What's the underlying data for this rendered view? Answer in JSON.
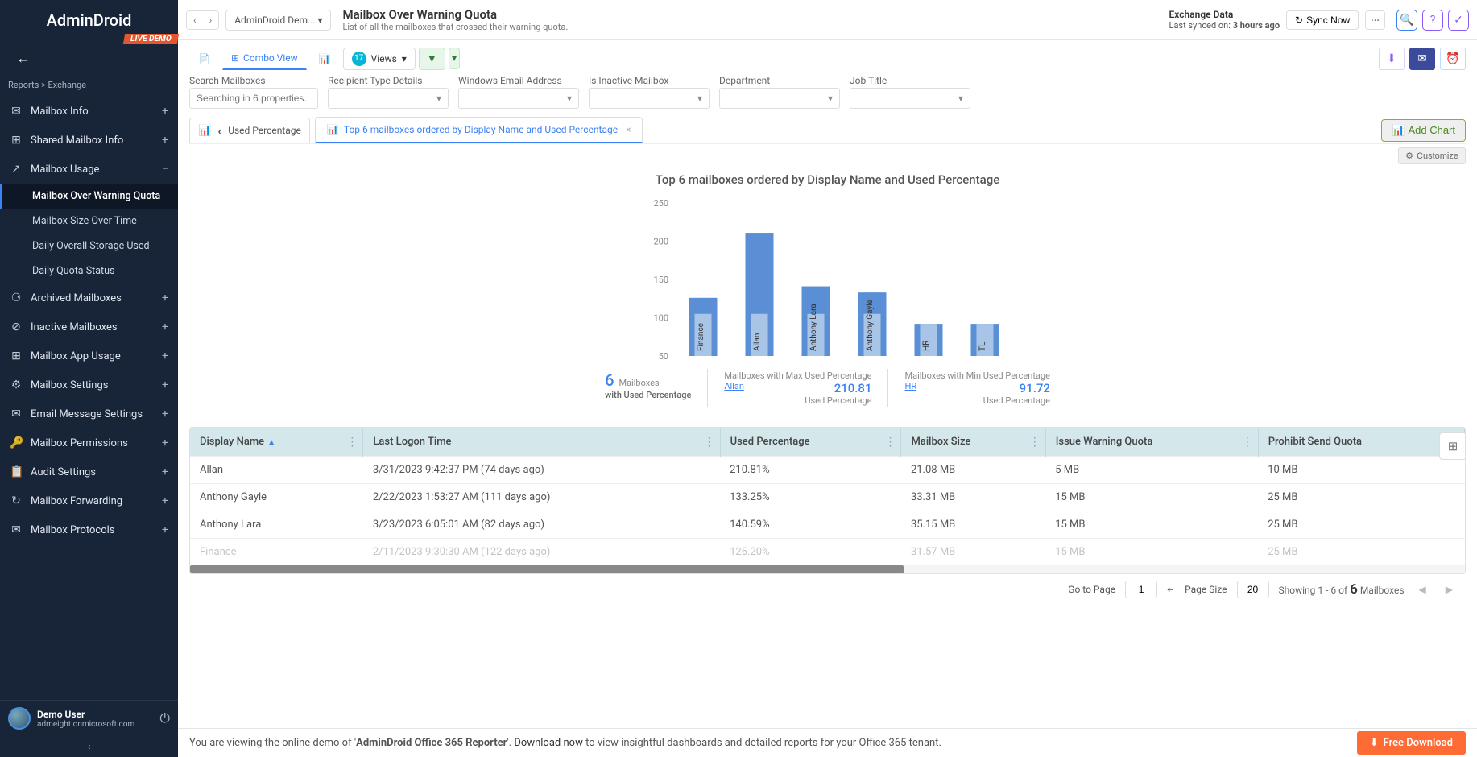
{
  "brand": "AdminDroid",
  "live_badge": "LIVE DEMO",
  "breadcrumb": "Reports > Exchange",
  "crumb_select": "AdminDroid Dem...",
  "sidebar": {
    "items": [
      {
        "icon": "✉",
        "label": "Mailbox Info",
        "expand": "+"
      },
      {
        "icon": "⊞",
        "label": "Shared Mailbox Info",
        "expand": "+"
      },
      {
        "icon": "↗",
        "label": "Mailbox Usage",
        "expand": "−"
      },
      {
        "icon": "⚆",
        "label": "Archived Mailboxes",
        "expand": "+"
      },
      {
        "icon": "⊘",
        "label": "Inactive Mailboxes",
        "expand": "+"
      },
      {
        "icon": "⊞",
        "label": "Mailbox App Usage",
        "expand": "+"
      },
      {
        "icon": "⚙",
        "label": "Mailbox Settings",
        "expand": "+"
      },
      {
        "icon": "✉",
        "label": "Email Message Settings",
        "expand": "+"
      },
      {
        "icon": "🔑",
        "label": "Mailbox Permissions",
        "expand": "+"
      },
      {
        "icon": "📋",
        "label": "Audit Settings",
        "expand": "+"
      },
      {
        "icon": "↻",
        "label": "Mailbox Forwarding",
        "expand": "+"
      },
      {
        "icon": "✉",
        "label": "Mailbox Protocols",
        "expand": "+"
      }
    ],
    "subs": [
      "Mailbox Over Warning Quota",
      "Mailbox Size Over Time",
      "Daily Overall Storage Used",
      "Daily Quota Status"
    ],
    "user_name": "Demo User",
    "user_email": "admeight.onmicrosoft.com"
  },
  "header": {
    "title": "Mailbox Over Warning Quota",
    "subtitle": "List of all the mailboxes that crossed their warning quota.",
    "sync_title": "Exchange Data",
    "sync_prefix": "Last synced on: ",
    "sync_time": "3 hours ago",
    "sync_now": "Sync Now"
  },
  "toolbar": {
    "combo": "Combo View",
    "views_count": "17",
    "views_label": "Views",
    "filters": {
      "search_label": "Search Mailboxes",
      "search_placeholder": "Searching in 6 properties.",
      "f1": "Recipient Type Details",
      "f2": "Windows Email Address",
      "f3": "Is Inactive Mailbox",
      "f4": "Department",
      "f5": "Job Title"
    }
  },
  "chart": {
    "side_tab": "Used Percentage",
    "main_tab": "Top 6 mailboxes ordered by Display Name and Used Percentage",
    "add": "Add Chart",
    "customize": "Customize",
    "title": "Top 6 mailboxes ordered by Display Name and Used Percentage",
    "stat1_num": "6",
    "stat1_l1": "Mailboxes",
    "stat1_l2": "with Used Percentage",
    "stat2_l1": "Mailboxes with Max Used Percentage",
    "stat2_num": "210.81",
    "stat2_link": "Allan",
    "stat2_r": "Used Percentage",
    "stat3_l1": "Mailboxes with Min Used Percentage",
    "stat3_num": "91.72",
    "stat3_link": "HR",
    "stat3_r": "Used Percentage"
  },
  "chart_data": {
    "type": "bar",
    "title": "Top 6 mailboxes ordered by Display Name and Used Percentage",
    "ylabel": "",
    "xlabel": "",
    "ylim": [
      50,
      250
    ],
    "yticks": [
      50,
      100,
      150,
      200,
      250
    ],
    "categories": [
      "Finance",
      "Allan",
      "Anthony Lara",
      "Anthony Gayle",
      "HR",
      "TL"
    ],
    "series": [
      {
        "name": "dark",
        "values": [
          126,
          211,
          141,
          133,
          92,
          92
        ]
      },
      {
        "name": "light",
        "values": [
          105,
          105,
          105,
          105,
          92,
          92
        ]
      }
    ]
  },
  "table": {
    "cols": [
      "Display Name",
      "Last Logon Time",
      "Used Percentage",
      "Mailbox Size",
      "Issue Warning Quota",
      "Prohibit Send Quota"
    ],
    "rows": [
      [
        "Allan",
        "3/31/2023 9:42:37 PM (74 days ago)",
        "210.81%",
        "21.08 MB",
        "5 MB",
        "10 MB"
      ],
      [
        "Anthony Gayle",
        "2/22/2023 1:53:27 AM (111 days ago)",
        "133.25%",
        "33.31 MB",
        "15 MB",
        "25 MB"
      ],
      [
        "Anthony Lara",
        "3/23/2023 6:05:01 AM (82 days ago)",
        "140.59%",
        "35.15 MB",
        "15 MB",
        "25 MB"
      ],
      [
        "Finance",
        "2/11/2023 9:30:30 AM (122 days ago)",
        "126.20%",
        "31.57 MB",
        "15 MB",
        "25 MB"
      ]
    ]
  },
  "paginator": {
    "goto": "Go to Page",
    "page": "1",
    "size_label": "Page Size",
    "size": "20",
    "showing_pre": "Showing ",
    "showing_range": "1 - 6",
    "showing_of": " of ",
    "showing_total": "6",
    "showing_suf": " Mailboxes"
  },
  "footer": {
    "t1": "You are viewing the online demo of '",
    "t2": "AdminDroid Office 365 Reporter",
    "t3": "'. ",
    "link": "Download now",
    "t4": " to view insightful dashboards and detailed reports for your Office 365 tenant.",
    "btn": "Free Download"
  }
}
